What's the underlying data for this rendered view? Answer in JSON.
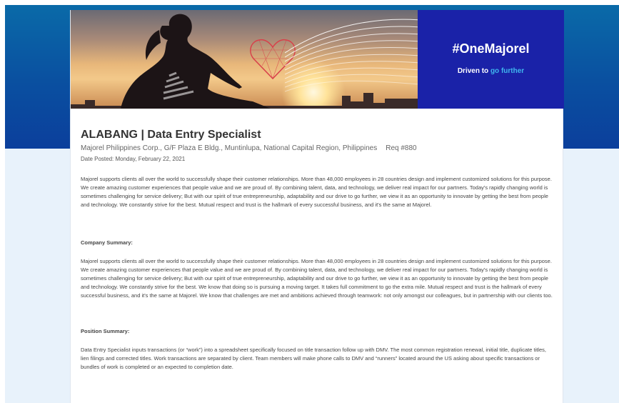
{
  "banner": {
    "hashtag": "#OneMajorel",
    "tagline_prefix": "Driven to",
    "tagline_accent": "go further",
    "brand_color": "#1a22a8",
    "accent_color": "#3fb6ee"
  },
  "job": {
    "title": "ALABANG | Data Entry Specialist",
    "location": "Majorel Philippines Corp., G/F Plaza E Bldg., Muntinlupa, National Capital Region, Philippines",
    "req": "Req #880",
    "date_posted": "Date Posted:  Monday, February 22, 2021"
  },
  "intro": "Majorel supports clients all over the world to successfully shape their customer relationships. More than 48,000 employees in 28 countries design and implement customized solutions for this purpose. We create amazing customer experiences that people value and we are proud of. By combining talent, data, and technology, we deliver real impact for our partners. Today's rapidly changing world is sometimes challenging for service delivery; But with our spirit of true entrepreneurship, adaptability and our drive to go further, we view it as an opportunity to innovate by getting the best from people and technology. We constantly strive for the best. Mutual respect and trust is the hallmark of every successful business, and it's the same at Majorel.",
  "company_summary": {
    "heading": "Company Summary:",
    "text": "Majorel supports clients all over the world to successfully shape their customer relationships. More than 48,000 employees in 28 countries design and implement customized solutions for this purpose. We create amazing customer experiences that people value and we are proud of. By combining talent, data, and technology, we deliver real impact for our partners. Today's rapidly changing world is sometimes challenging for service delivery; But with our spirit of true entrepreneurship, adaptability and our drive to go further, we view it as an opportunity to innovate by getting the best from people and technology. We constantly strive for the best. We know that doing so is pursuing a moving target. It takes full commitment to go the extra mile. Mutual respect and trust is the hallmark of every successful business, and it's the same at Majorel. We know that challenges are met and ambitions achieved through teamwork: not only amongst our colleagues, but in partnership with our clients too."
  },
  "position_summary": {
    "heading": "Position Summary:",
    "text": "Data Entry Specialist inputs transactions (or “work”) into a spreadsheet specifically focused on title transaction follow up with DMV.  The most common registration renewal, initial title,  duplicate titles, lien filings and corrected titles. Work transactions are separated by client. Team members will make phone calls to DMV and “runners” located around the US asking about specific transactions or bundles of work is completed or an expected to completion date."
  }
}
